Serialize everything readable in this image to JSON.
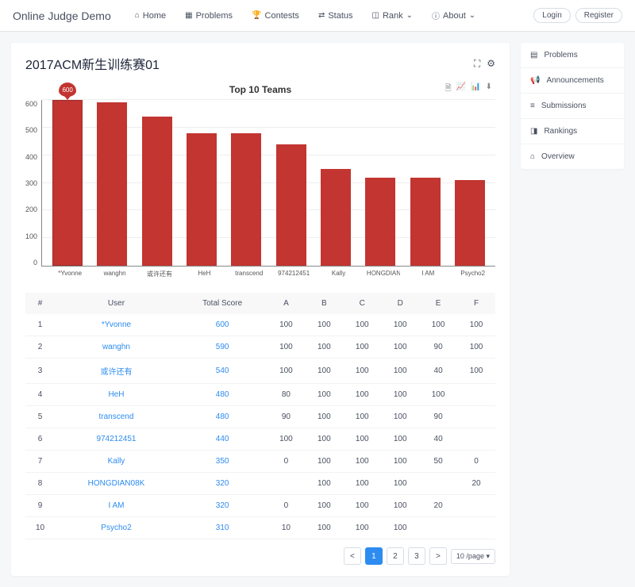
{
  "brand": "Online Judge Demo",
  "nav": [
    {
      "icon": "⌂",
      "label": "Home"
    },
    {
      "icon": "▦",
      "label": "Problems"
    },
    {
      "icon": "🏆",
      "label": "Contests"
    },
    {
      "icon": "⇄",
      "label": "Status"
    },
    {
      "icon": "◫",
      "label": "Rank",
      "caret": "⌄"
    },
    {
      "icon": "ⓘ",
      "label": "About",
      "caret": "⌄"
    }
  ],
  "auth": {
    "login": "Login",
    "register": "Register"
  },
  "page_title": "2017ACM新生训练赛01",
  "chart_data": {
    "type": "bar",
    "title": "Top 10 Teams",
    "ylabel": "",
    "xlabel": "",
    "ylim": [
      0,
      600
    ],
    "yticks": [
      0,
      100,
      200,
      300,
      400,
      500,
      600
    ],
    "categories": [
      "*Yvonne",
      "wanghn",
      "或许还有",
      "HeH",
      "transcend",
      "974212451",
      "Kally",
      "HONGDIAN08K",
      "I AM",
      "Psycho2"
    ],
    "values": [
      600,
      590,
      540,
      480,
      480,
      440,
      350,
      320,
      320,
      310
    ],
    "highlight_index": 0,
    "highlight_value": 600
  },
  "table": {
    "headers": [
      "#",
      "User",
      "Total Score",
      "A",
      "B",
      "C",
      "D",
      "E",
      "F"
    ],
    "rows": [
      {
        "rank": "1",
        "user": "*Yvonne",
        "score": "600",
        "cells": [
          "100",
          "100",
          "100",
          "100",
          "100",
          "100"
        ]
      },
      {
        "rank": "2",
        "user": "wanghn",
        "score": "590",
        "cells": [
          "100",
          "100",
          "100",
          "100",
          "90",
          "100"
        ]
      },
      {
        "rank": "3",
        "user": "或许还有",
        "score": "540",
        "cells": [
          "100",
          "100",
          "100",
          "100",
          "40",
          "100"
        ]
      },
      {
        "rank": "4",
        "user": "HeH",
        "score": "480",
        "cells": [
          "80",
          "100",
          "100",
          "100",
          "100",
          ""
        ]
      },
      {
        "rank": "5",
        "user": "transcend",
        "score": "480",
        "cells": [
          "90",
          "100",
          "100",
          "100",
          "90",
          ""
        ]
      },
      {
        "rank": "6",
        "user": "974212451",
        "score": "440",
        "cells": [
          "100",
          "100",
          "100",
          "100",
          "40",
          ""
        ]
      },
      {
        "rank": "7",
        "user": "Kally",
        "score": "350",
        "cells": [
          "0",
          "100",
          "100",
          "100",
          "50",
          "0"
        ]
      },
      {
        "rank": "8",
        "user": "HONGDIAN08K",
        "score": "320",
        "cells": [
          "",
          "100",
          "100",
          "100",
          "",
          "20"
        ]
      },
      {
        "rank": "9",
        "user": "I AM",
        "score": "320",
        "cells": [
          "0",
          "100",
          "100",
          "100",
          "20",
          ""
        ]
      },
      {
        "rank": "10",
        "user": "Psycho2",
        "score": "310",
        "cells": [
          "10",
          "100",
          "100",
          "100",
          "",
          ""
        ]
      }
    ]
  },
  "pagination": {
    "prev": "<",
    "pages": [
      "1",
      "2",
      "3"
    ],
    "active": 1,
    "next": ">",
    "page_size": "10 /page"
  },
  "sidebar": [
    {
      "icon": "▤",
      "label": "Problems"
    },
    {
      "icon": "📢",
      "label": "Announcements"
    },
    {
      "icon": "≡",
      "label": "Submissions"
    },
    {
      "icon": "◨",
      "label": "Rankings"
    },
    {
      "icon": "⌂",
      "label": "Overview"
    }
  ]
}
